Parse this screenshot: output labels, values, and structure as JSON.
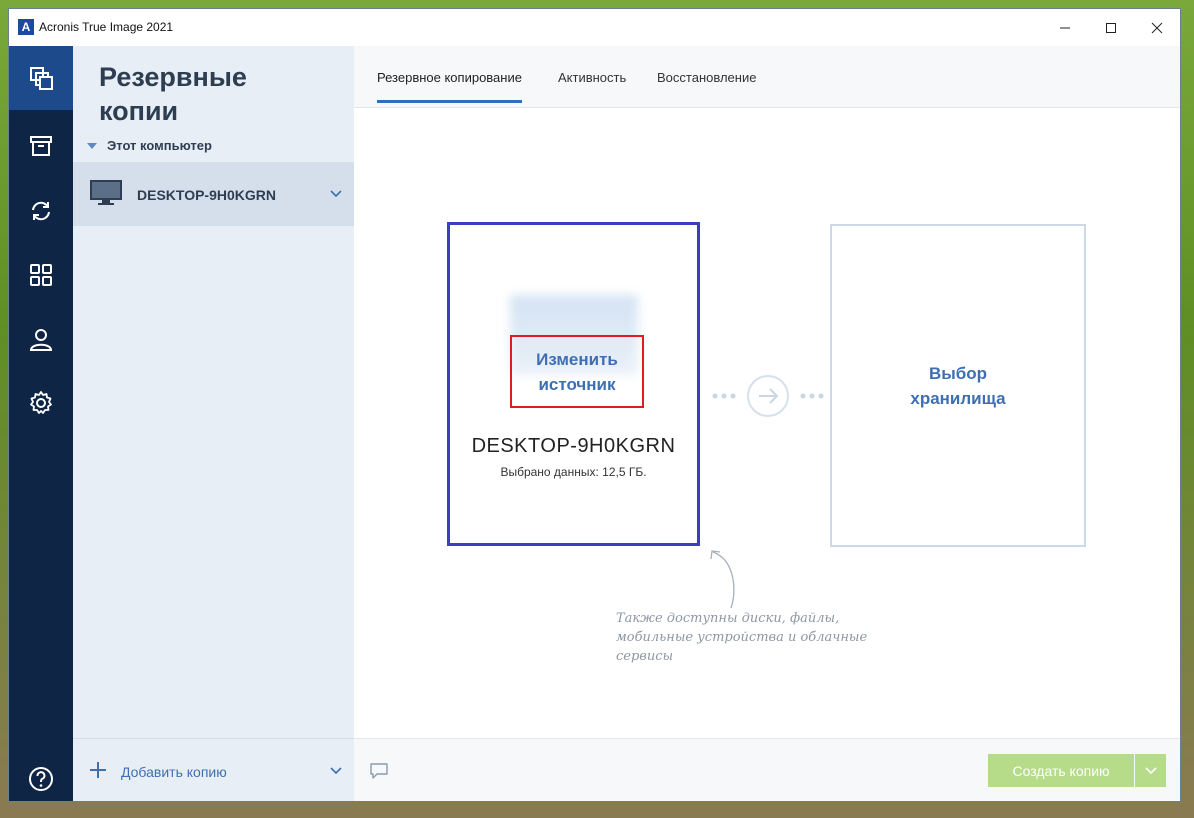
{
  "window": {
    "title": "Acronis True Image 2021",
    "logo_letter": "A"
  },
  "nav": {
    "items": [
      {
        "name": "backup",
        "icon": "copies-icon",
        "active": true
      },
      {
        "name": "archive",
        "icon": "archive-icon",
        "active": false
      },
      {
        "name": "sync",
        "icon": "sync-icon",
        "active": false
      },
      {
        "name": "tools",
        "icon": "grid-icon",
        "active": false
      },
      {
        "name": "account",
        "icon": "user-icon",
        "active": false
      },
      {
        "name": "settings",
        "icon": "gear-icon",
        "active": false
      }
    ],
    "help_icon": "help-icon"
  },
  "sidebar": {
    "title": "Резервные копии",
    "group_label": "Этот компьютер",
    "item": {
      "label": "DESKTOP-9H0KGRN",
      "icon": "monitor-icon"
    },
    "add_label": "Добавить копию"
  },
  "tabs": [
    {
      "label": "Резервное копирование",
      "active": true
    },
    {
      "label": "Активность",
      "active": false
    },
    {
      "label": "Восстановление",
      "active": false
    }
  ],
  "source": {
    "change_label": "Изменить источник",
    "name": "DESKTOP-9H0KGRN",
    "subtitle": "Выбрано данных: 12,5 ГБ."
  },
  "destination": {
    "label": "Выбор хранилища"
  },
  "hint": "Также доступны диски, файлы, мобильные устройства и облачные сервисы",
  "footer": {
    "create_label": "Создать копию"
  },
  "colors": {
    "nav_bg": "#0f2546",
    "nav_active": "#1c4a8a",
    "accent_text": "#3e6fb3",
    "create_btn": "#b6dc8a",
    "highlight_red": "#e11b22",
    "source_border": "#3b3fbf"
  }
}
